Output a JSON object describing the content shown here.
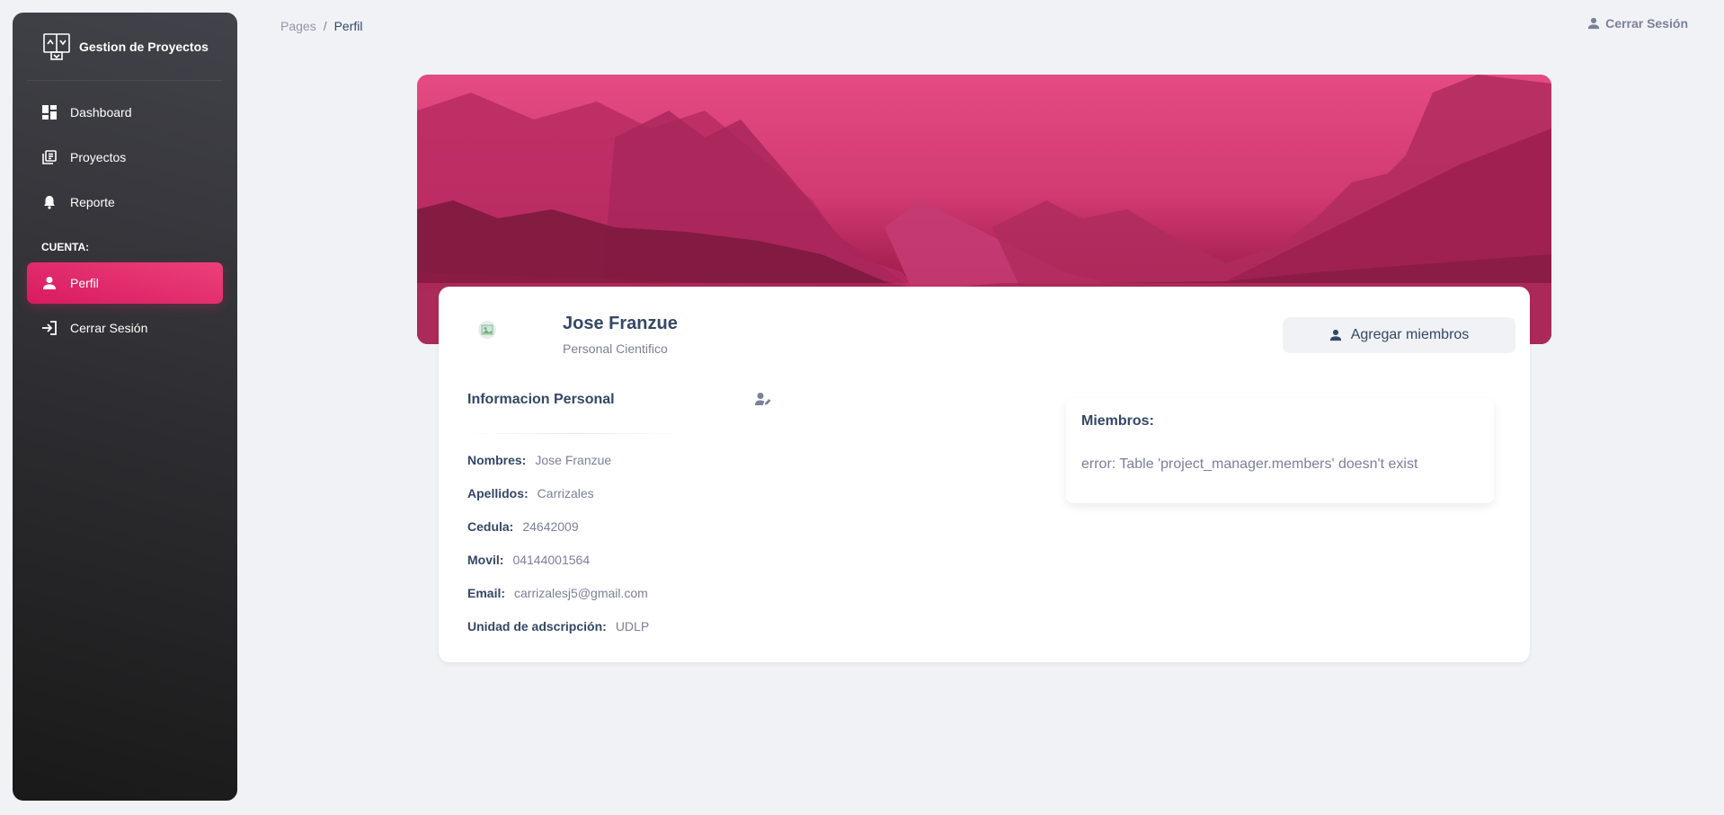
{
  "sidebar": {
    "brand": "Gestion de Proyectos",
    "items": [
      {
        "label": "Dashboard",
        "icon": "dashboard-icon"
      },
      {
        "label": "Proyectos",
        "icon": "library-books-icon"
      },
      {
        "label": "Reporte",
        "icon": "bell-icon"
      }
    ],
    "section_label": "CUENTA:",
    "account_items": [
      {
        "label": "Perfil",
        "icon": "person-icon",
        "active": true
      },
      {
        "label": "Cerrar Sesión",
        "icon": "login-icon"
      }
    ]
  },
  "breadcrumb": {
    "root": "Pages",
    "separator": "/",
    "current": "Perfil"
  },
  "topbar": {
    "logout_label": "Cerrar Sesión"
  },
  "profile": {
    "name": "Jose Franzue",
    "role": "Personal Cientifico",
    "add_members_label": "Agregar miembros"
  },
  "personal_info": {
    "title": "Informacion Personal",
    "fields": [
      {
        "label": "Nombres:",
        "value": "Jose Franzue"
      },
      {
        "label": "Apellidos:",
        "value": "Carrizales"
      },
      {
        "label": "Cedula:",
        "value": "24642009"
      },
      {
        "label": "Movil:",
        "value": "04144001564"
      },
      {
        "label": "Email:",
        "value": "carrizalesj5@gmail.com"
      },
      {
        "label": "Unidad de adscripción:",
        "value": "UDLP"
      }
    ]
  },
  "members": {
    "title": "Miembros:",
    "error": "error: Table 'project_manager.members' doesn't exist"
  },
  "colors": {
    "accent": "#e91e63",
    "sidebar_dark": "#191919",
    "text_dark": "#344767",
    "text_muted": "#7b809a"
  }
}
